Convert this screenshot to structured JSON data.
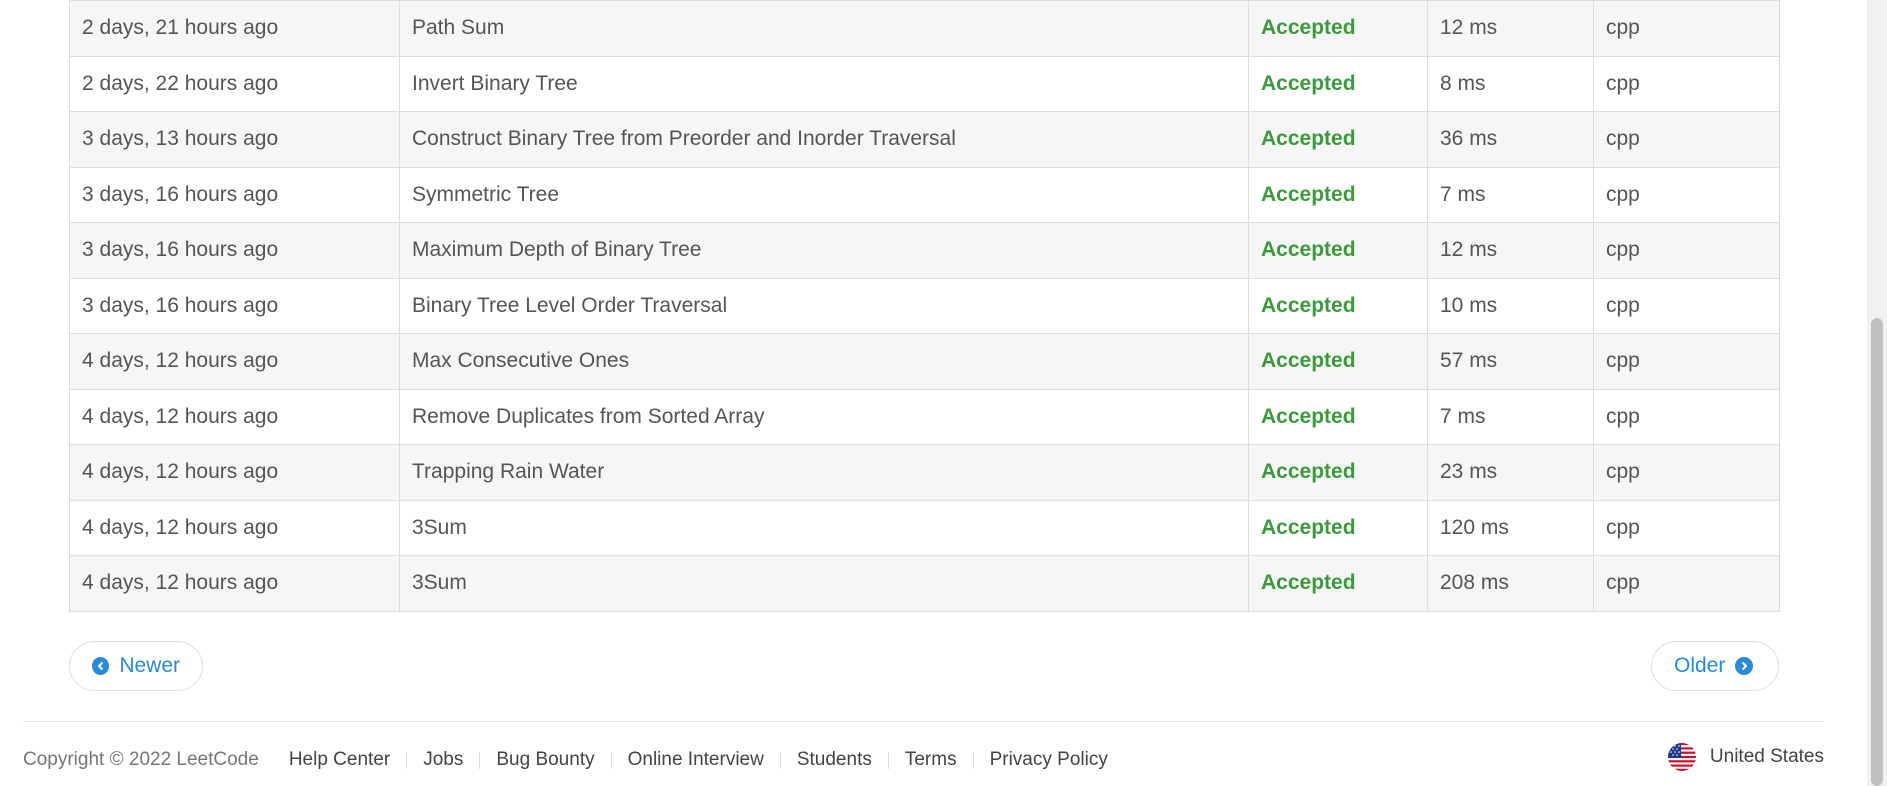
{
  "submissions": [
    {
      "time": "2 days, 21 hours ago",
      "question": "Path Sum",
      "status": "Accepted",
      "runtime": "12 ms",
      "language": "cpp"
    },
    {
      "time": "2 days, 22 hours ago",
      "question": "Invert Binary Tree",
      "status": "Accepted",
      "runtime": "8 ms",
      "language": "cpp"
    },
    {
      "time": "3 days, 13 hours ago",
      "question": "Construct Binary Tree from Preorder and Inorder Traversal",
      "status": "Accepted",
      "runtime": "36 ms",
      "language": "cpp"
    },
    {
      "time": "3 days, 16 hours ago",
      "question": "Symmetric Tree",
      "status": "Accepted",
      "runtime": "7 ms",
      "language": "cpp"
    },
    {
      "time": "3 days, 16 hours ago",
      "question": "Maximum Depth of Binary Tree",
      "status": "Accepted",
      "runtime": "12 ms",
      "language": "cpp"
    },
    {
      "time": "3 days, 16 hours ago",
      "question": "Binary Tree Level Order Traversal",
      "status": "Accepted",
      "runtime": "10 ms",
      "language": "cpp"
    },
    {
      "time": "4 days, 12 hours ago",
      "question": "Max Consecutive Ones",
      "status": "Accepted",
      "runtime": "57 ms",
      "language": "cpp"
    },
    {
      "time": "4 days, 12 hours ago",
      "question": "Remove Duplicates from Sorted Array",
      "status": "Accepted",
      "runtime": "7 ms",
      "language": "cpp"
    },
    {
      "time": "4 days, 12 hours ago",
      "question": "Trapping Rain Water",
      "status": "Accepted",
      "runtime": "23 ms",
      "language": "cpp"
    },
    {
      "time": "4 days, 12 hours ago",
      "question": "3Sum",
      "status": "Accepted",
      "runtime": "120 ms",
      "language": "cpp"
    },
    {
      "time": "4 days, 12 hours ago",
      "question": "3Sum",
      "status": "Accepted",
      "runtime": "208 ms",
      "language": "cpp"
    }
  ],
  "pagination": {
    "newer_label": "Newer",
    "older_label": "Older",
    "newer_icon": "chevron-left-circle-icon",
    "older_icon": "chevron-right-circle-icon"
  },
  "footer": {
    "copyright": "Copyright © 2022 LeetCode",
    "links": [
      "Help Center",
      "Jobs",
      "Bug Bounty",
      "Online Interview",
      "Students",
      "Terms",
      "Privacy Policy"
    ],
    "region": "United States",
    "region_icon": "us-flag-icon"
  },
  "colors": {
    "accepted": "#3c9a3c",
    "link_blue": "#2b8ad8"
  }
}
